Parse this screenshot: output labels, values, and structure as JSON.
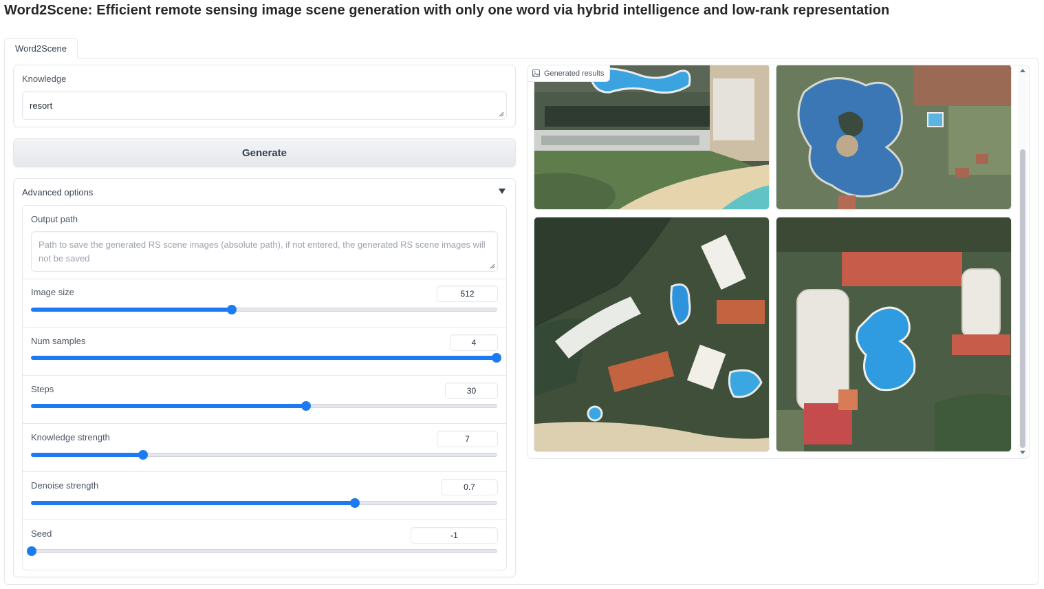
{
  "page": {
    "title": "Word2Scene: Efficient remote sensing image scene generation with only one word via hybrid intelligence and low-rank representation"
  },
  "tabs": [
    {
      "label": "Word2Scene",
      "active": true
    }
  ],
  "knowledge": {
    "label": "Knowledge",
    "value": "resort"
  },
  "generate_button": {
    "label": "Generate"
  },
  "advanced": {
    "label": "Advanced options",
    "expanded": true,
    "output_path": {
      "label": "Output path",
      "placeholder": "Path to save the generated RS scene images (absolute path), if not entered, the generated RS scene images will not be saved"
    },
    "sliders": [
      {
        "label": "Image size",
        "value": "512",
        "fraction": 0.43
      },
      {
        "label": "Num samples",
        "value": "4",
        "fraction": 1.0
      },
      {
        "label": "Steps",
        "value": "30",
        "fraction": 0.59
      },
      {
        "label": "Knowledge strength",
        "value": "7",
        "fraction": 0.24
      },
      {
        "label": "Denoise strength",
        "value": "0.7",
        "fraction": 0.695
      },
      {
        "label": "Seed",
        "value": "-1",
        "fraction": 0.0
      }
    ]
  },
  "gallery": {
    "label": "Generated results",
    "images": [
      {
        "name": "resort-scene-1"
      },
      {
        "name": "resort-scene-2"
      },
      {
        "name": "resort-scene-3"
      },
      {
        "name": "resort-scene-4"
      }
    ]
  },
  "colors": {
    "accent": "#1d7bf2",
    "border": "#e5e7eb",
    "button_bg": "#e5e7eb",
    "water": "#2a8fd6",
    "vegetation": "#3f5a3a",
    "sand": "#e3d3b0"
  },
  "icons": {
    "gallery_label": "image-icon",
    "collapse": "caret-down-icon"
  }
}
